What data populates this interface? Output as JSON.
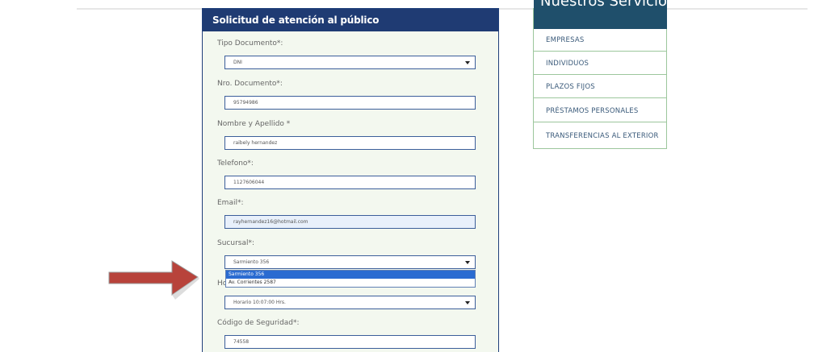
{
  "form": {
    "title": "Solicitud de atención al público",
    "fields": {
      "tipo_documento": {
        "label": "Tipo Documento*:",
        "value": "DNI"
      },
      "nro_documento": {
        "label": "Nro. Documento*:",
        "value": "95794986"
      },
      "nombre": {
        "label": "Nombre y Apellido *",
        "value": "raibely hernandez"
      },
      "telefono": {
        "label": "Telefono*:",
        "value": "1127606044"
      },
      "email": {
        "label": "Email*:",
        "value": "rayhernandez16@hotmail.com"
      },
      "sucursal": {
        "label": "Sucursal*:",
        "value": "Sarmiento 356",
        "options": [
          "Sarmiento 356",
          "Av. Corrientes 2587"
        ]
      },
      "horario": {
        "label": "Ho",
        "value": "Horario 10:07:00 Hrs."
      },
      "codigo": {
        "label": "Código de Seguridad*:",
        "value": "74558"
      }
    }
  },
  "services": {
    "title": "Nuestros Servicios",
    "items": [
      "EMPRESAS",
      "INDIVIDUOS",
      "PLAZOS FIJOS",
      "PRÉSTAMOS PERSONALES",
      "TRANSFERENCIAS AL EXTERIOR"
    ]
  },
  "colors": {
    "header": "#1f3b73",
    "panel_bg": "#f3f8ef",
    "services_border": "#9cc69c",
    "arrow": "#b8433b"
  },
  "annotation": {
    "icon": "red-arrow-icon"
  }
}
